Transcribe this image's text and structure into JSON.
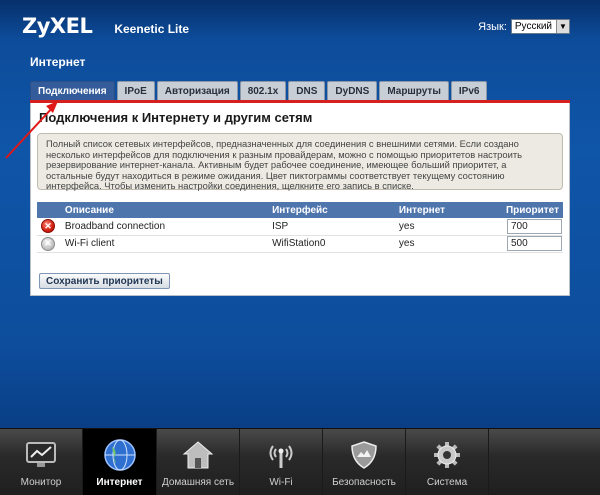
{
  "brand": {
    "logo": "ZyXEL",
    "model": "Keenetic Lite"
  },
  "lang": {
    "label": "Язык:",
    "value": "Русский"
  },
  "page": {
    "title": "Интернет"
  },
  "tabs": [
    {
      "label": "Подключения",
      "active": true
    },
    {
      "label": "IPoE"
    },
    {
      "label": "Авторизация"
    },
    {
      "label": "802.1x"
    },
    {
      "label": "DNS"
    },
    {
      "label": "DyDNS"
    },
    {
      "label": "Маршруты"
    },
    {
      "label": "IPv6"
    }
  ],
  "panel": {
    "title": "Подключения к Интернету и другим сетям",
    "description": "Полный список сетевых интерфейсов, предназначенных для соединения с внешними сетями. Если создано несколько интерфейсов для подключения к разным провайдерам, можно с помощью приоритетов настроить резервирование интернет-канала. Активным будет рабочее соединение, имеющее больший приоритет, а остальные будут находиться в режиме ожидания. Цвет пиктограммы соответствует текущему состоянию интерфейса. Чтобы изменить настройки соединения, щелкните его запись в списке."
  },
  "table": {
    "headers": {
      "desc": "Описание",
      "iface": "Интерфейс",
      "inet": "Интернет",
      "prio": "Приоритет"
    },
    "rows": [
      {
        "status": "error",
        "status_icon": "red-x-icon",
        "desc": "Broadband connection",
        "iface": "ISP",
        "inet": "yes",
        "prio": "700"
      },
      {
        "status": "off",
        "status_icon": "grey-x-icon",
        "desc": "Wi-Fi client",
        "iface": "WifiStation0",
        "inet": "yes",
        "prio": "500"
      }
    ]
  },
  "buttons": {
    "save": "Сохранить приоритеты"
  },
  "colors": {
    "accent_red": "#d62020",
    "tab_active": "#355c9a",
    "header_blue": "#4f75ad"
  },
  "nav": [
    {
      "label": "Монитор",
      "icon": "monitor-icon"
    },
    {
      "label": "Интернет",
      "icon": "globe-icon",
      "active": true
    },
    {
      "label": "Домашняя сеть",
      "icon": "home-icon"
    },
    {
      "label": "Wi-Fi",
      "icon": "wifi-antenna-icon"
    },
    {
      "label": "Безопасность",
      "icon": "shield-icon"
    },
    {
      "label": "Система",
      "icon": "gear-icon"
    }
  ]
}
